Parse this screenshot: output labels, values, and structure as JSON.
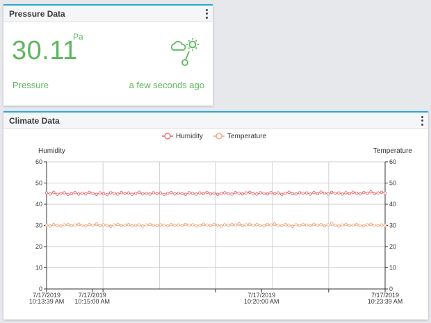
{
  "pressure_card": {
    "title": "Pressure Data",
    "value": "30.11",
    "unit": "Pa",
    "label": "Pressure",
    "updated": "a few seconds ago",
    "icon": "weather-sensor-icon",
    "accent": "#5cb85c"
  },
  "climate_card": {
    "title": "Climate Data"
  },
  "chart_data": {
    "type": "line",
    "legend_placement": "top-center",
    "ylabel_left": "Humidity",
    "ylabel_right": "Temperature",
    "ylim": [
      0,
      60
    ],
    "yticks": [
      0,
      10,
      20,
      30,
      40,
      50,
      60
    ],
    "xticks": [
      {
        "date": "7/17/2019",
        "time": "10:13:39 AM",
        "t": 0
      },
      {
        "date": "7/17/2019",
        "time": "10:15:00 AM",
        "t": 81
      },
      {
        "date": "7/17/2019",
        "time": "10:20:00 AM",
        "t": 381
      },
      {
        "date": "7/17/2019",
        "time": "10:23:39 AM",
        "t": 600
      }
    ],
    "x_range_seconds": [
      0,
      600
    ],
    "grid": true,
    "series": [
      {
        "name": "Humidity",
        "color": "#e8666a",
        "values": [
          45.3,
          44.9,
          45.6,
          44.7,
          45.1,
          45.4,
          44.6,
          45.0,
          45.5,
          44.8,
          45.2,
          44.9,
          45.6,
          45.1,
          44.7,
          45.3,
          45.0,
          44.6,
          45.4,
          45.2,
          44.8,
          45.5,
          45.0,
          45.3,
          44.7,
          45.1,
          45.6,
          44.9,
          45.2,
          44.8,
          45.4,
          45.0,
          45.3,
          44.6,
          45.1,
          45.5,
          44.9,
          45.2,
          45.0,
          44.7,
          45.4,
          45.1,
          44.8,
          45.3,
          45.0,
          45.6,
          44.9,
          45.2,
          44.7,
          45.1,
          45.4,
          45.0,
          44.8,
          45.5,
          45.2,
          44.9,
          45.3,
          45.6,
          45.0,
          44.8,
          45.4,
          45.1,
          44.9,
          45.5,
          45.0,
          45.3,
          44.7,
          45.2,
          45.6,
          45.0,
          44.9,
          45.4,
          45.1,
          45.3,
          44.8,
          45.5,
          45.0,
          45.7,
          45.2,
          44.9,
          45.6,
          45.1,
          45.3,
          44.8,
          45.4,
          45.0,
          45.6,
          45.2,
          44.9,
          45.5,
          45.1,
          45.8,
          45.0,
          45.3,
          45.6,
          45.2
        ]
      },
      {
        "name": "Temperature",
        "color": "#f0a57a",
        "values": [
          30.1,
          29.8,
          30.4,
          30.0,
          29.7,
          30.3,
          30.5,
          29.9,
          30.2,
          30.6,
          30.0,
          29.8,
          30.4,
          30.1,
          30.7,
          29.9,
          30.3,
          30.0,
          29.6,
          30.2,
          30.5,
          29.9,
          30.1,
          30.4,
          29.8,
          30.0,
          30.3,
          29.7,
          30.2,
          30.5,
          30.0,
          29.9,
          30.3,
          30.1,
          29.8,
          30.4,
          30.0,
          30.2,
          29.9,
          30.5,
          30.1,
          30.3,
          29.8,
          30.0,
          30.6,
          30.2,
          29.9,
          30.4,
          30.1,
          29.7,
          30.3,
          30.0,
          30.5,
          30.2,
          30.8,
          29.9,
          30.3,
          30.6,
          30.1,
          30.4,
          30.0,
          29.8,
          30.5,
          30.2,
          30.7,
          30.0,
          29.9,
          30.4,
          30.1,
          29.6,
          30.3,
          30.0,
          30.5,
          30.2,
          29.9,
          30.6,
          30.1,
          30.4,
          29.8,
          30.3,
          31.0,
          30.0,
          29.7,
          30.2,
          30.5,
          29.9,
          30.1,
          30.4,
          30.0,
          29.8,
          30.3,
          30.6,
          30.1,
          29.9,
          30.2,
          30.0
        ]
      }
    ]
  }
}
